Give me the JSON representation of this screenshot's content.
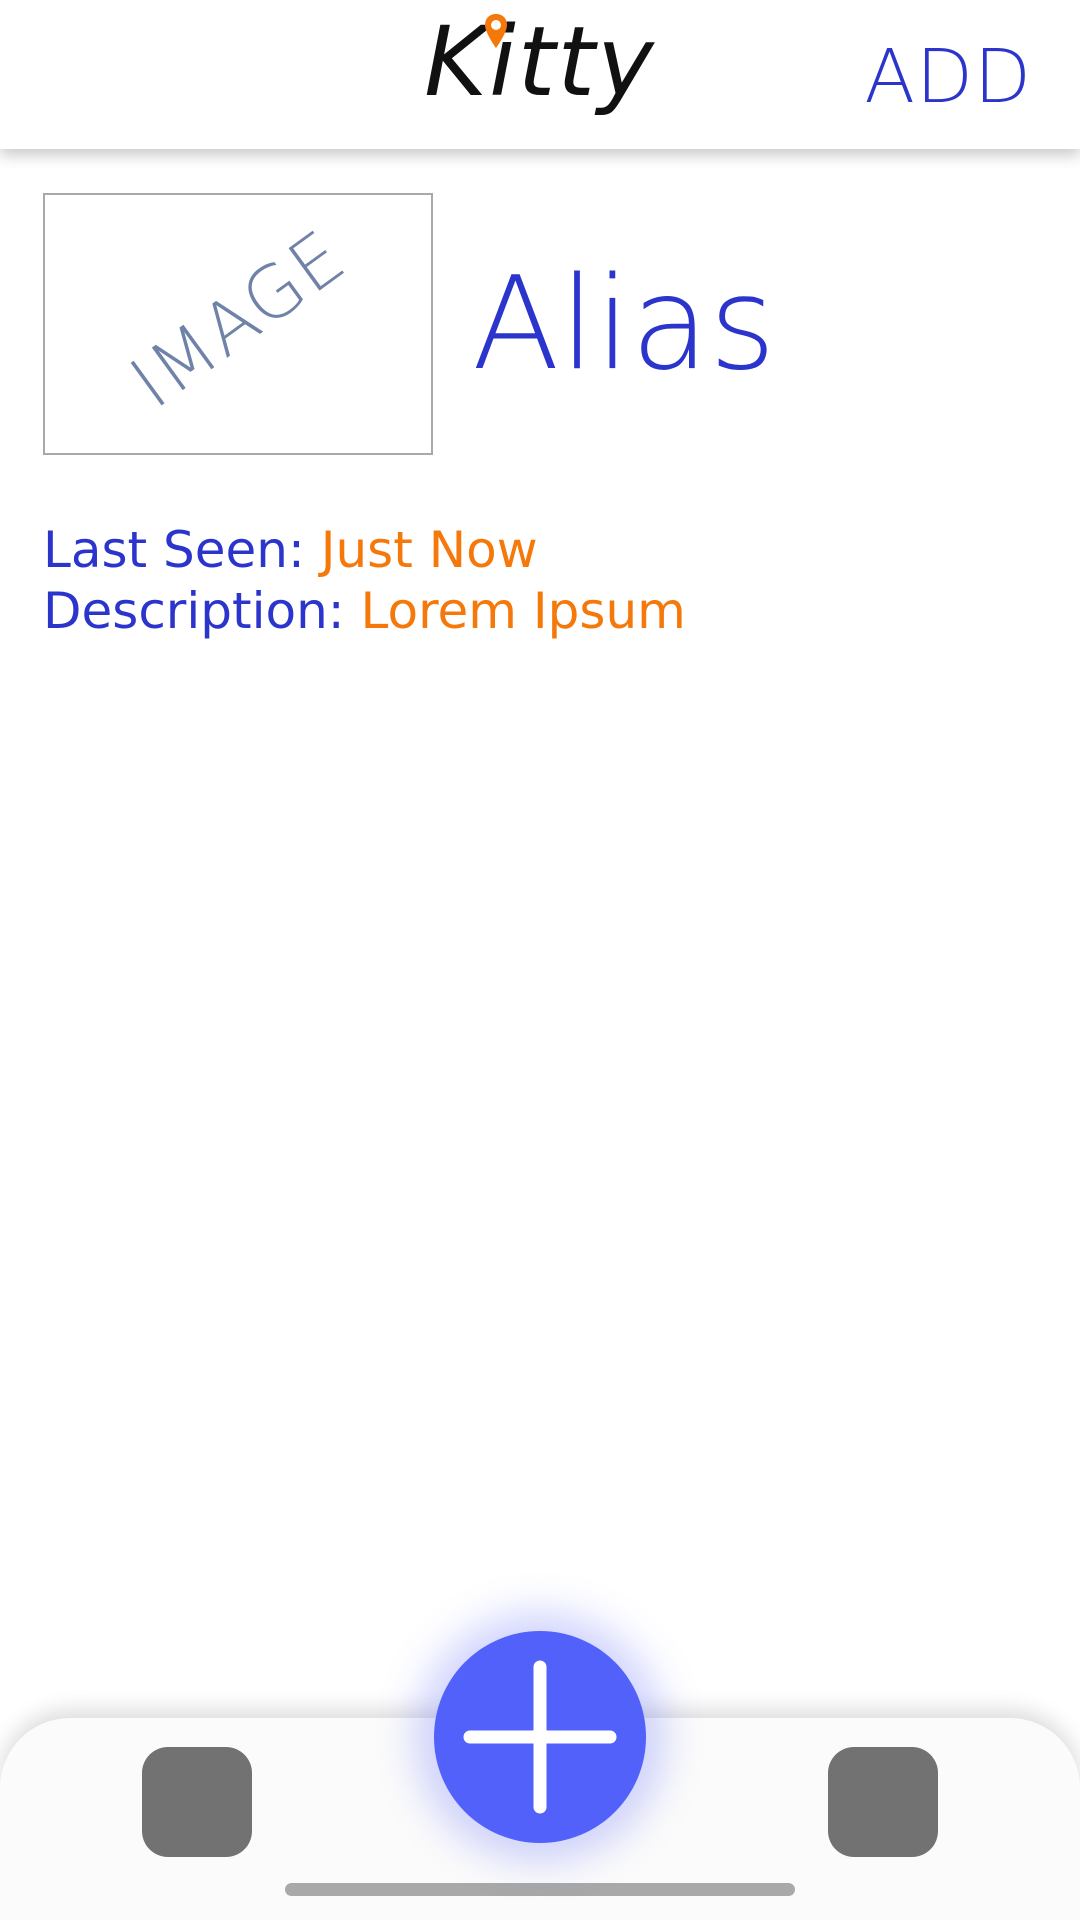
{
  "header": {
    "logo_text": "Kitty",
    "add_label": "ADD"
  },
  "profile": {
    "image_placeholder": "IMAGE",
    "alias": "Alias",
    "last_seen_label": "Last Seen: ",
    "last_seen_value": "Just Now",
    "description_label": "Description: ",
    "description_value": "Lorem Ipsum"
  },
  "tabbar": {
    "left_tab_icon": "square-icon",
    "right_tab_icon": "square-icon",
    "fab_icon": "plus-icon"
  },
  "colors": {
    "accent_blue": "#2b35cc",
    "accent_orange": "#f5780a",
    "fab_blue": "#5361fb",
    "tab_gray": "#727272"
  }
}
